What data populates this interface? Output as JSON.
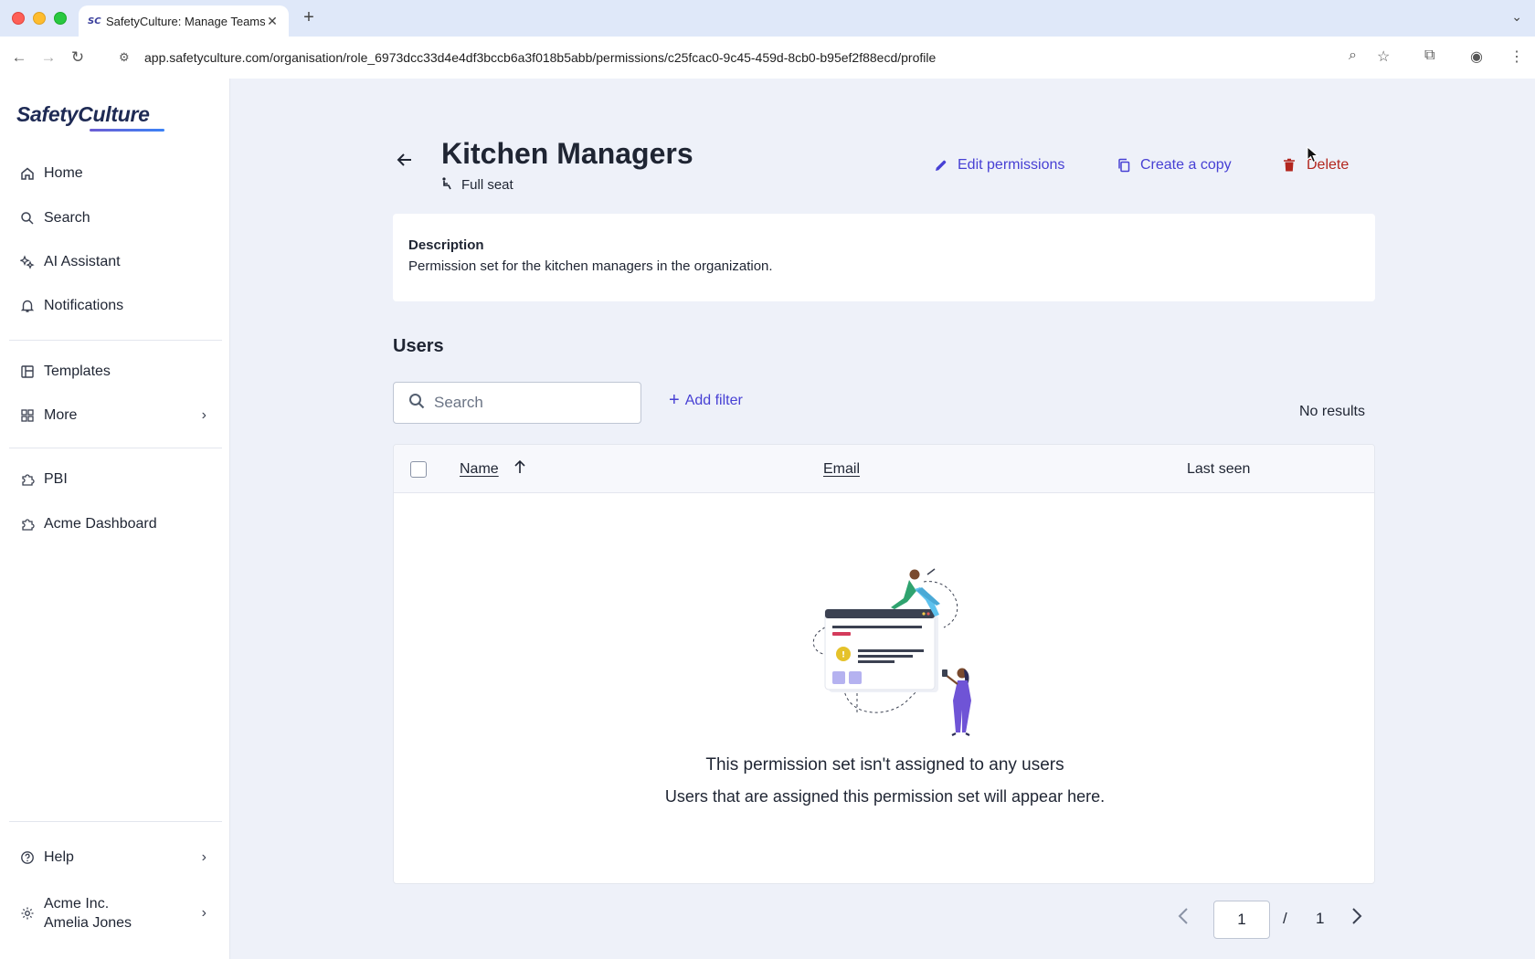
{
  "browser": {
    "tab_title": "SafetyCulture: Manage Teams",
    "tab_favicon": "SC",
    "url": "app.safetyculture.com/organisation/role_6973dcc33d4e4df3bccb6a3f018b5abb/permissions/c25fcac0-9c45-459d-8cb0-b95ef2f88ecd/profile"
  },
  "sidebar": {
    "logo": "SafetyCulture",
    "items": [
      {
        "label": "Home",
        "icon": "home-icon"
      },
      {
        "label": "Search",
        "icon": "search-icon"
      },
      {
        "label": "AI Assistant",
        "icon": "sparkle-icon"
      },
      {
        "label": "Notifications",
        "icon": "bell-icon"
      },
      {
        "label": "Templates",
        "icon": "template-icon"
      },
      {
        "label": "More",
        "icon": "grid-icon"
      },
      {
        "label": "PBI",
        "icon": "puzzle-icon"
      },
      {
        "label": "Acme Dashboard",
        "icon": "puzzle-icon"
      }
    ],
    "help": "Help",
    "org_name": "Acme Inc.",
    "user_name": "Amelia Jones"
  },
  "page": {
    "title": "Kitchen Managers",
    "seat": "Full seat",
    "actions": {
      "edit": "Edit permissions",
      "copy": "Create a copy",
      "delete": "Delete"
    },
    "description_heading": "Description",
    "description_text": "Permission set for the kitchen managers in the organization.",
    "users_heading": "Users",
    "search_placeholder": "Search",
    "add_filter": "Add filter",
    "no_results": "No results",
    "columns": {
      "name": "Name",
      "email": "Email",
      "last_seen": "Last seen"
    },
    "empty_title": "This permission set isn't assigned to any users",
    "empty_subtitle": "Users that are assigned this permission set will appear here.",
    "pagination": {
      "current": "1",
      "separator": "/",
      "total": "1"
    }
  },
  "colors": {
    "accent": "#4740d4",
    "danger": "#b3261e",
    "sidebar_bg": "#ffffff",
    "main_bg": "#eef1f9"
  }
}
